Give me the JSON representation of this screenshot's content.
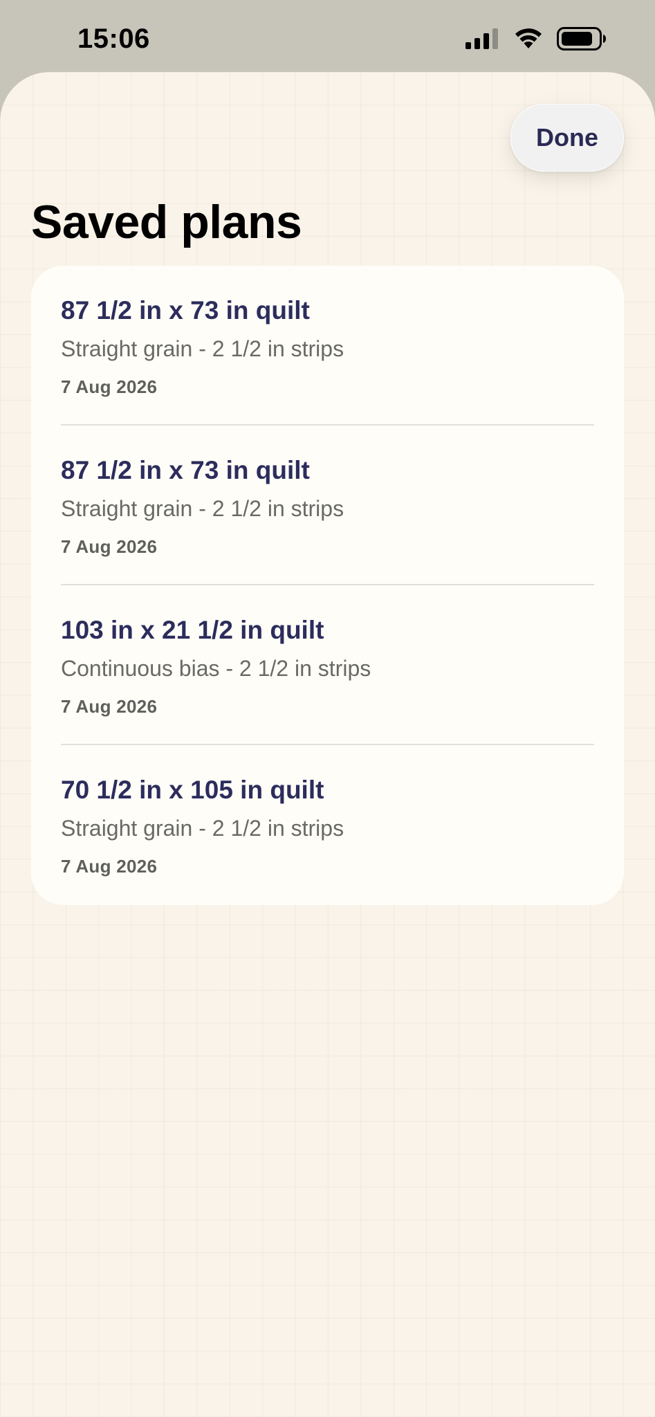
{
  "status_bar": {
    "time": "15:06"
  },
  "header": {
    "done_label": "Done",
    "title": "Saved plans"
  },
  "plans": [
    {
      "title": "87 1/2 in x 73 in quilt",
      "subtitle": "Straight grain - 2 1/2 in strips",
      "date": "7 Aug 2026"
    },
    {
      "title": "87 1/2 in x 73 in quilt",
      "subtitle": "Straight grain - 2 1/2 in strips",
      "date": "7 Aug 2026"
    },
    {
      "title": "103 in x 21 1/2 in quilt",
      "subtitle": "Continuous bias - 2 1/2 in strips",
      "date": "7 Aug 2026"
    },
    {
      "title": "70 1/2 in x 105 in quilt",
      "subtitle": "Straight grain - 2 1/2 in strips",
      "date": "7 Aug 2026"
    }
  ],
  "icons": {
    "signal": "cellular-signal-icon",
    "wifi": "wifi-icon",
    "battery": "battery-icon"
  },
  "colors": {
    "title_accent": "#2c2d5c",
    "sheet_background": "#f9f3e9",
    "card_background": "#fefdf8"
  }
}
